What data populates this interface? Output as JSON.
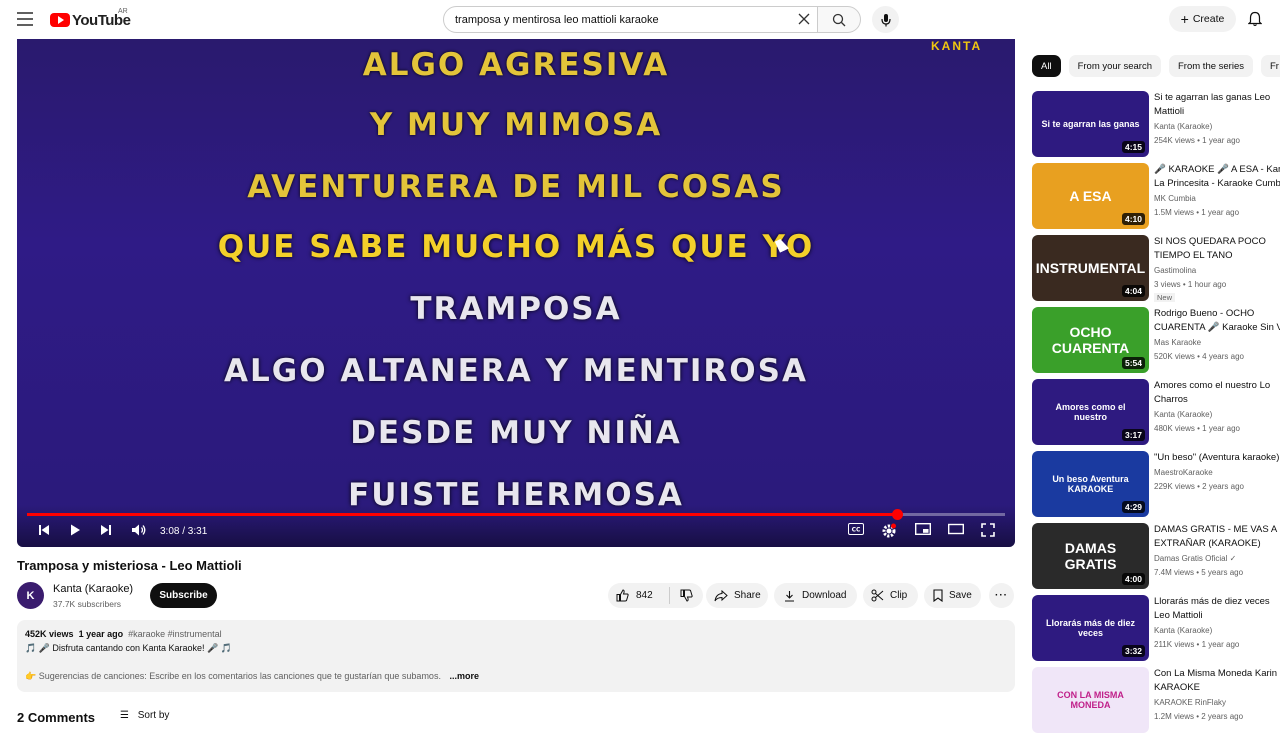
{
  "header": {
    "logo_text": "YouTube",
    "country": "AR",
    "search_value": "tramposa y mentirosa leo mattioli karaoke",
    "create_label": "Create"
  },
  "player": {
    "watermark": "KANTA",
    "lyrics": [
      {
        "text": "ALGO AGRESIVA",
        "state": "sung"
      },
      {
        "text": "Y MUY MIMOSA",
        "state": "sung"
      },
      {
        "text": "AVENTURERA DE MIL COSAS",
        "state": "sung"
      },
      {
        "text": "QUE SABE MUCHO MÁS QUE YO",
        "state": "current"
      },
      {
        "text": "TRAMPOSA",
        "state": "next"
      },
      {
        "text": "ALGO ALTANERA Y MENTIROSA",
        "state": "next"
      },
      {
        "text": "DESDE MUY NIÑA",
        "state": "next"
      },
      {
        "text": "FUISTE HERMOSA",
        "state": "next"
      }
    ],
    "time_display": "3:08 / 3:31",
    "progress_fraction": 0.89
  },
  "video": {
    "title": "Tramposa y misteriosa - Leo Mattioli",
    "channel": "Kanta (Karaoke)",
    "subscribers": "37.7K subscribers",
    "subscribe_label": "Subscribe",
    "likes": "842",
    "share_label": "Share",
    "download_label": "Download",
    "clip_label": "Clip",
    "save_label": "Save",
    "views": "452K views",
    "age": "1 year ago",
    "tags": "#karaoke #instrumental",
    "desc_line1": "🎵 🎤 Disfruta cantando con Kanta Karaoke! 🎤 🎵",
    "desc_line2": "👉 Sugerencias de canciones: Escribe en los comentarios las canciones que te gustarían que subamos.",
    "more_label": "...more",
    "comments_label": "2 Comments",
    "sort_label": "Sort by"
  },
  "sidebar": {
    "chips": [
      "All",
      "From your search",
      "From the series",
      "Fr"
    ],
    "recommendations": [
      {
        "title": "Si te agarran las ganas   Leo",
        "title2": "Mattioli",
        "channel": "Kanta (Karaoke)",
        "meta": "254K views • 1 year ago",
        "duration": "4:15",
        "thumb_text": "Si te agarran las ganas",
        "thumb_bg": "#2e1a80",
        "thumb_color": "#ffffff",
        "badge": ""
      },
      {
        "title": "🎤 KARAOKE 🎤 A ESA - Kar",
        "title2": "La Princesita - Karaoke Cumb",
        "channel": "MK Cumbia",
        "meta": "1.5M views • 1 year ago",
        "duration": "4:10",
        "thumb_text": "A ESA",
        "thumb_bg": "#e8a020",
        "thumb_color": "#ffffff",
        "badge": ""
      },
      {
        "title": "SI NOS QUEDARA POCO",
        "title2": "TIEMPO EL  TANO",
        "channel": "Gastimolina",
        "meta": "3 views • 1 hour ago",
        "duration": "4:04",
        "thumb_text": "INSTRUMENTAL",
        "thumb_bg": "#3a2a20",
        "thumb_color": "#ffffff",
        "badge": "New"
      },
      {
        "title": "Rodrigo Bueno - OCHO",
        "title2": "CUARENTA 🎤 Karaoke Sin V",
        "channel": "Mas Karaoke",
        "meta": "520K views • 4 years ago",
        "duration": "5:54",
        "thumb_text": "OCHO CUARENTA",
        "thumb_bg": "#3aa02a",
        "thumb_color": "#ffffff",
        "badge": ""
      },
      {
        "title": "Amores como el nuestro   Lo",
        "title2": "Charros",
        "channel": "Kanta (Karaoke)",
        "meta": "480K views • 1 year ago",
        "duration": "3:17",
        "thumb_text": "Amores como el nuestro",
        "thumb_bg": "#2e1a80",
        "thumb_color": "#ffffff",
        "badge": ""
      },
      {
        "title": "\"Un beso\" (Aventura karaoke)",
        "title2": "",
        "channel": "MaestroKaraoke",
        "meta": "229K views • 2 years ago",
        "duration": "4:29",
        "thumb_text": "Un beso Aventura KARAOKE",
        "thumb_bg": "#1a3aa0",
        "thumb_color": "#ffffff",
        "badge": ""
      },
      {
        "title": "DAMAS GRATIS - ME VAS A",
        "title2": "EXTRAÑAR (KARAOKE)",
        "channel": "Damas Gratis Oficial ✓",
        "meta": "7.4M views • 5 years ago",
        "duration": "4:00",
        "thumb_text": "DAMAS GRATIS",
        "thumb_bg": "#2a2a2a",
        "thumb_color": "#ffffff",
        "badge": ""
      },
      {
        "title": "Llorarás más de diez veces",
        "title2": "Leo Mattioli",
        "channel": "Kanta (Karaoke)",
        "meta": "211K views • 1 year ago",
        "duration": "3:32",
        "thumb_text": "Llorarás más de diez veces",
        "thumb_bg": "#2e1a80",
        "thumb_color": "#ffffff",
        "badge": ""
      },
      {
        "title": "Con La Misma Moneda Karin",
        "title2": "KARAOKE",
        "channel": "KARAOKE RinFlaky",
        "meta": "1.2M views • 2 years ago",
        "duration": "",
        "thumb_text": "CON LA MISMA MONEDA",
        "thumb_bg": "#f0e6f8",
        "thumb_color": "#c0208a",
        "badge": ""
      }
    ]
  }
}
